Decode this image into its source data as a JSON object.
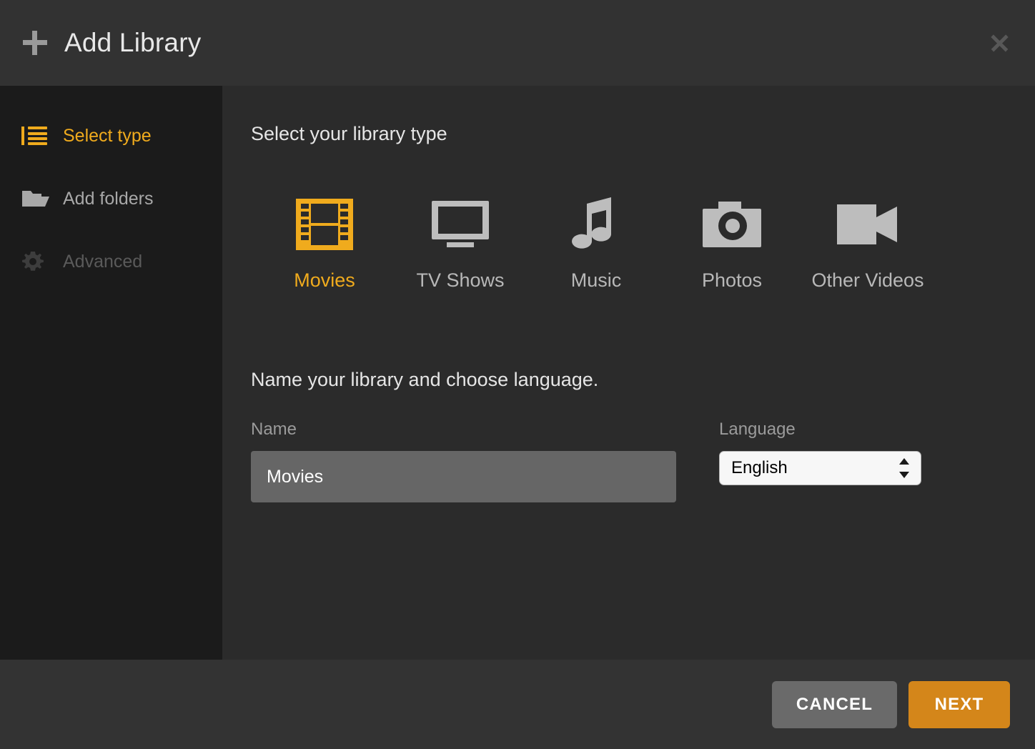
{
  "header": {
    "title": "Add Library",
    "plus_icon": "plus-icon",
    "close_icon": "close-icon"
  },
  "sidebar": {
    "items": [
      {
        "label": "Select type",
        "icon": "list-icon",
        "state": "active"
      },
      {
        "label": "Add folders",
        "icon": "folder-icon",
        "state": "enabled"
      },
      {
        "label": "Advanced",
        "icon": "gear-icon",
        "state": "disabled"
      }
    ]
  },
  "main": {
    "type_heading": "Select your library type",
    "types": [
      {
        "label": "Movies",
        "icon": "film-strip-icon",
        "selected": true
      },
      {
        "label": "TV Shows",
        "icon": "television-icon",
        "selected": false
      },
      {
        "label": "Music",
        "icon": "music-note-icon",
        "selected": false
      },
      {
        "label": "Photos",
        "icon": "camera-icon",
        "selected": false
      },
      {
        "label": "Other Videos",
        "icon": "video-camera-icon",
        "selected": false
      }
    ],
    "form_heading": "Name your library and choose language.",
    "name_field": {
      "label": "Name",
      "value": "Movies",
      "placeholder": "Name"
    },
    "language_field": {
      "label": "Language",
      "value": "English",
      "options": [
        "English"
      ]
    }
  },
  "footer": {
    "cancel_label": "CANCEL",
    "next_label": "NEXT"
  },
  "colors": {
    "accent": "#f0ab1d",
    "next_button": "#d4861a",
    "cancel_button": "#6a6a6a",
    "sidebar_bg": "#1b1b1b",
    "main_bg": "#2b2b2b",
    "header_bg": "#323232",
    "footer_bg": "#333333",
    "icon_gray": "#bdbdbd"
  }
}
